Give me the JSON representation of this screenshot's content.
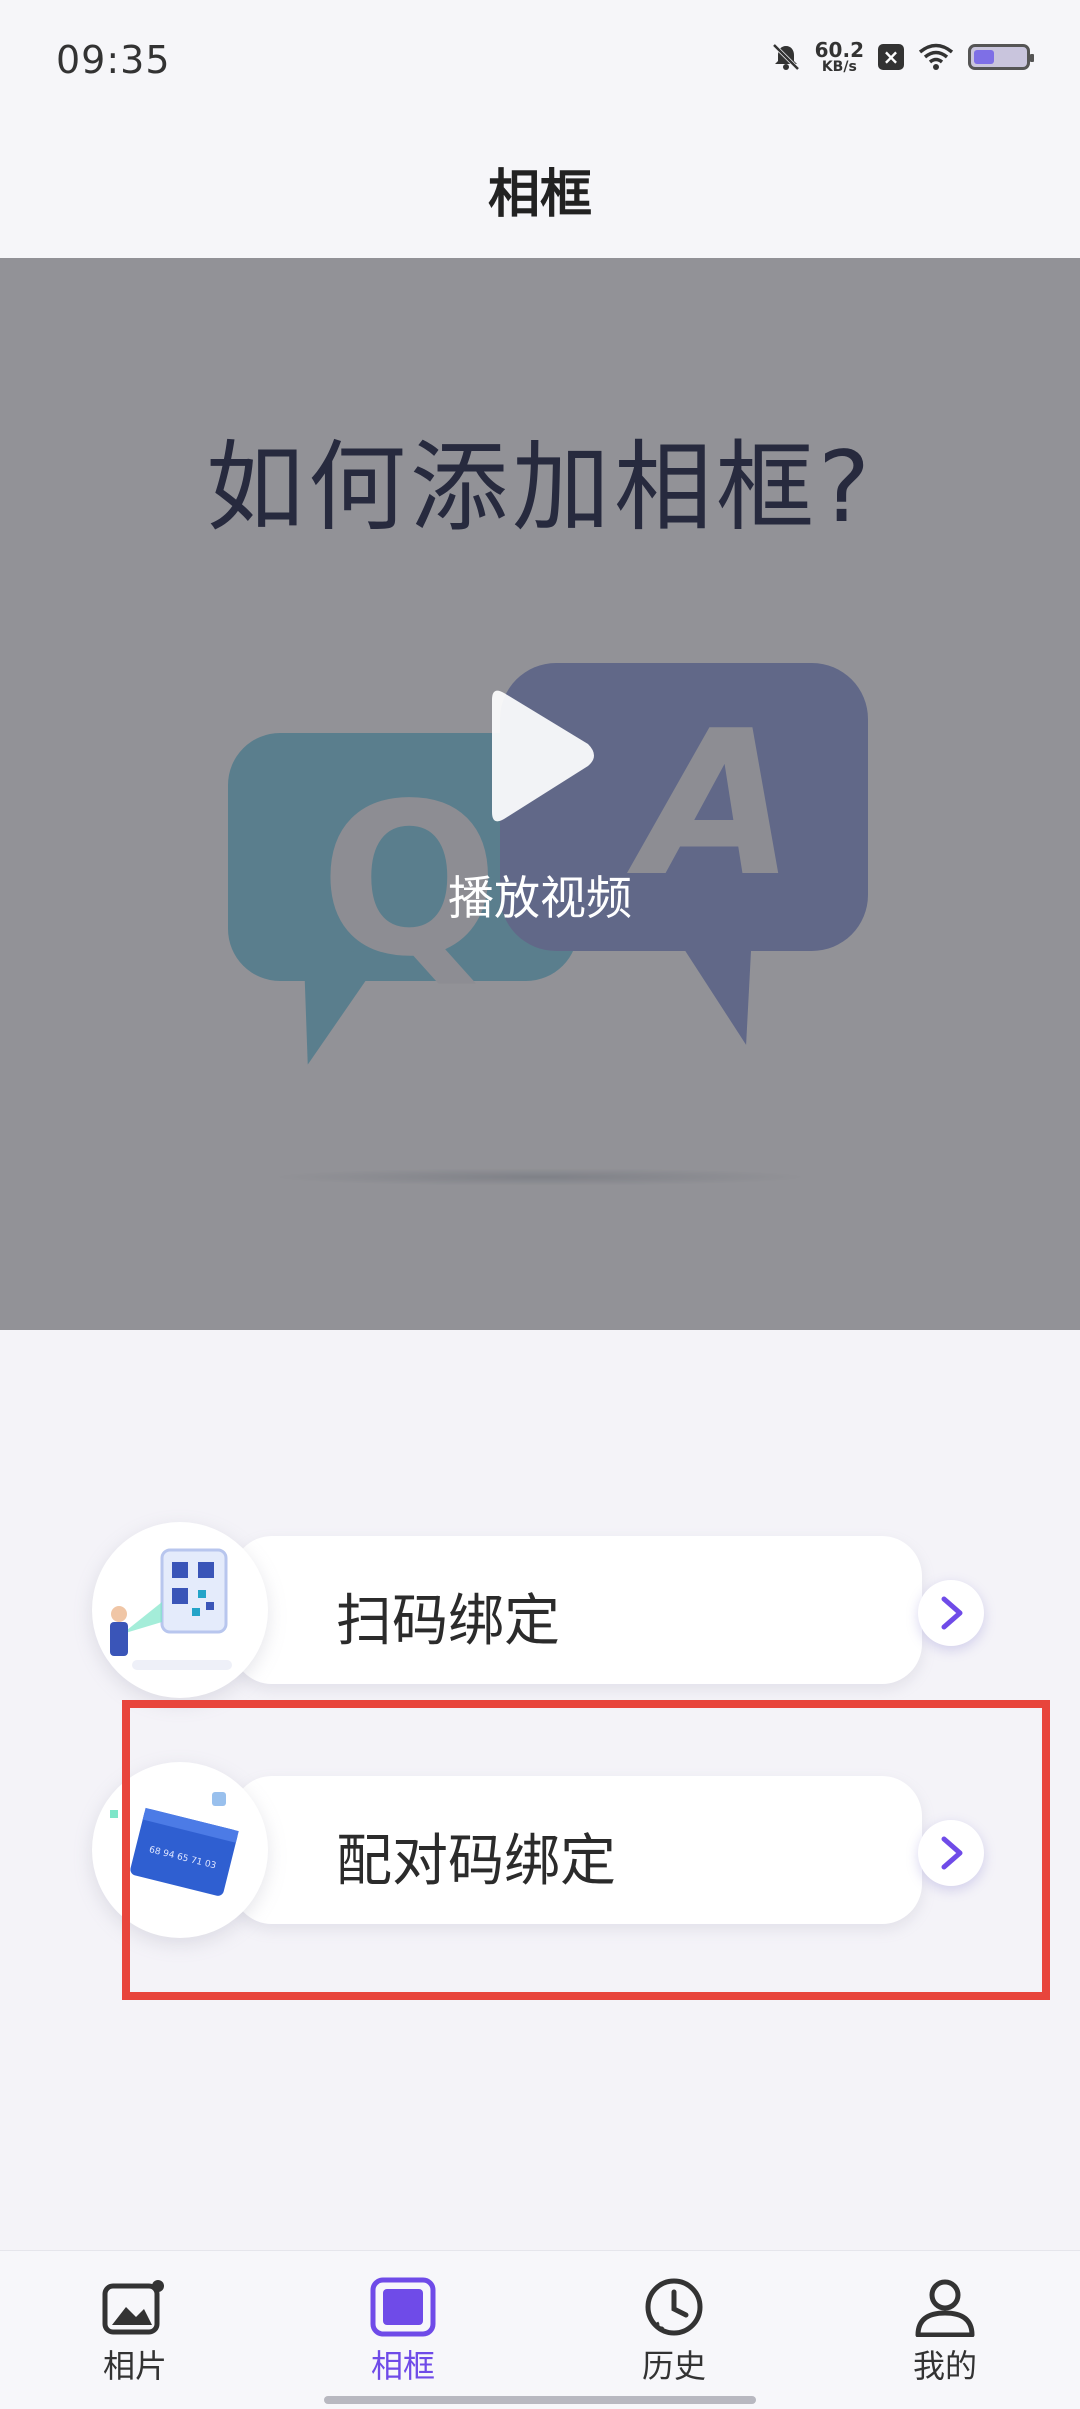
{
  "status_bar": {
    "time": "09:35",
    "net_speed_value": "60.2",
    "net_speed_unit": "KB/s"
  },
  "header": {
    "title": "相框"
  },
  "video": {
    "title": "如何添加相框?",
    "q_letter": "Q",
    "a_letter": "A",
    "play_label": "播放视频"
  },
  "options": [
    {
      "label": "扫码绑定"
    },
    {
      "label": "配对码绑定",
      "card_number": "68 94 65 71 03"
    }
  ],
  "nav": {
    "items": [
      {
        "label": "相片",
        "icon": "photo-icon"
      },
      {
        "label": "相框",
        "icon": "frame-icon",
        "active": true
      },
      {
        "label": "历史",
        "icon": "history-icon"
      },
      {
        "label": "我的",
        "icon": "profile-icon"
      }
    ]
  },
  "colors": {
    "accent": "#6f4be8",
    "highlight": "#e8453c"
  }
}
